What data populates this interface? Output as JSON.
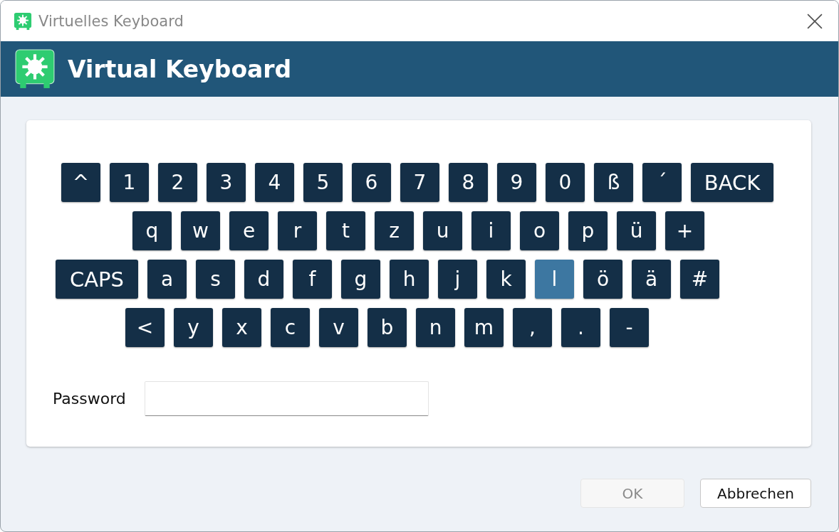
{
  "window": {
    "title": "Virtuelles Keyboard"
  },
  "header": {
    "title": "Virtual Keyboard"
  },
  "keyboard": {
    "rows": [
      [
        {
          "label": "^",
          "kind": "key",
          "selected": false
        },
        {
          "label": "1",
          "kind": "key",
          "selected": false
        },
        {
          "label": "2",
          "kind": "key",
          "selected": false
        },
        {
          "label": "3",
          "kind": "key",
          "selected": false
        },
        {
          "label": "4",
          "kind": "key",
          "selected": false
        },
        {
          "label": "5",
          "kind": "key",
          "selected": false
        },
        {
          "label": "6",
          "kind": "key",
          "selected": false
        },
        {
          "label": "7",
          "kind": "key",
          "selected": false
        },
        {
          "label": "8",
          "kind": "key",
          "selected": false
        },
        {
          "label": "9",
          "kind": "key",
          "selected": false
        },
        {
          "label": "0",
          "kind": "key",
          "selected": false
        },
        {
          "label": "ß",
          "kind": "key",
          "selected": false
        },
        {
          "label": "´",
          "kind": "key",
          "selected": false
        },
        {
          "label": "BACK",
          "kind": "wide",
          "selected": false
        }
      ],
      [
        {
          "label": "q",
          "kind": "key",
          "selected": false
        },
        {
          "label": "w",
          "kind": "key",
          "selected": false
        },
        {
          "label": "e",
          "kind": "key",
          "selected": false
        },
        {
          "label": "r",
          "kind": "key",
          "selected": false
        },
        {
          "label": "t",
          "kind": "key",
          "selected": false
        },
        {
          "label": "z",
          "kind": "key",
          "selected": false
        },
        {
          "label": "u",
          "kind": "key",
          "selected": false
        },
        {
          "label": "i",
          "kind": "key",
          "selected": false
        },
        {
          "label": "o",
          "kind": "key",
          "selected": false
        },
        {
          "label": "p",
          "kind": "key",
          "selected": false
        },
        {
          "label": "ü",
          "kind": "key",
          "selected": false
        },
        {
          "label": "+",
          "kind": "key",
          "selected": false
        }
      ],
      [
        {
          "label": "CAPS",
          "kind": "wide",
          "selected": false
        },
        {
          "label": "a",
          "kind": "key",
          "selected": false
        },
        {
          "label": "s",
          "kind": "key",
          "selected": false
        },
        {
          "label": "d",
          "kind": "key",
          "selected": false
        },
        {
          "label": "f",
          "kind": "key",
          "selected": false
        },
        {
          "label": "g",
          "kind": "key",
          "selected": false
        },
        {
          "label": "h",
          "kind": "key",
          "selected": false
        },
        {
          "label": "j",
          "kind": "key",
          "selected": false
        },
        {
          "label": "k",
          "kind": "key",
          "selected": false
        },
        {
          "label": "l",
          "kind": "key",
          "selected": true
        },
        {
          "label": "ö",
          "kind": "key",
          "selected": false
        },
        {
          "label": "ä",
          "kind": "key",
          "selected": false
        },
        {
          "label": "#",
          "kind": "key",
          "selected": false
        }
      ],
      [
        {
          "label": "<",
          "kind": "key",
          "selected": false
        },
        {
          "label": "y",
          "kind": "key",
          "selected": false
        },
        {
          "label": "x",
          "kind": "key",
          "selected": false
        },
        {
          "label": "c",
          "kind": "key",
          "selected": false
        },
        {
          "label": "v",
          "kind": "key",
          "selected": false
        },
        {
          "label": "b",
          "kind": "key",
          "selected": false
        },
        {
          "label": "n",
          "kind": "key",
          "selected": false
        },
        {
          "label": "m",
          "kind": "key",
          "selected": false
        },
        {
          "label": ",",
          "kind": "key",
          "selected": false
        },
        {
          "label": ".",
          "kind": "key",
          "selected": false
        },
        {
          "label": "-",
          "kind": "key",
          "selected": false
        }
      ]
    ]
  },
  "password": {
    "label": "Password"
  },
  "buttons": [
    {
      "label": "OK",
      "disabled": true
    },
    {
      "label": "Abbrechen",
      "disabled": false
    }
  ]
}
